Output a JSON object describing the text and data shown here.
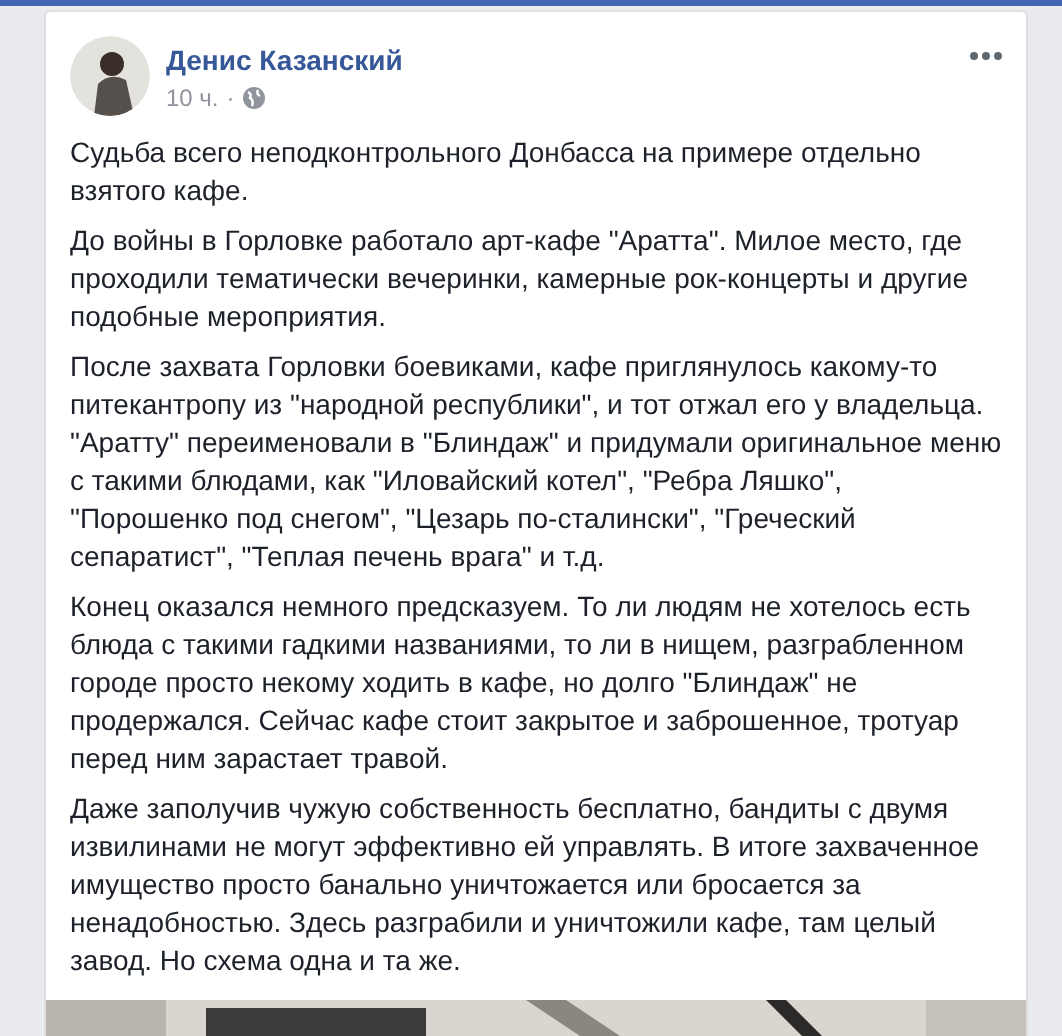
{
  "post": {
    "author": "Денис Казанский",
    "time": "10 ч.",
    "separator": "·",
    "paragraphs": [
      "Судьба всего неподконтрольного Донбасса на примере отдельно взятого кафе.",
      "До войны в Горловке работало арт-кафе \"Аратта\". Милое место, где проходили тематически вечеринки, камерные рок-концерты и другие подобные мероприятия.",
      "После захвата Горловки боевиками, кафе приглянулось какому-то питекантропу из \"народной республики\", и тот отжал его у владельца. \"Аратту\" переименовали в \"Блиндаж\" и придумали оригинальное меню с такими блюдами, как \"Иловайский котел\", \"Ребра Ляшко\", \"Порошенко под снегом\", \"Цезарь по-сталински\", \"Греческий сепаратист\", \"Теплая печень врага\" и т.д.",
      "Конец оказался немного предсказуем. То ли людям не хотелось есть блюда с такими гадкими названиями, то ли в нищем, разграбленном городе просто некому ходить в кафе, но долго \"Блиндаж\" не продержался. Сейчас кафе стоит закрытое и заброшенное, тротуар перед ним зарастает травой.",
      "Даже заполучив чужую собственность бесплатно, бандиты с двумя извилинами не могут эффективно ей управлять. В итоге захваченное имущество просто банально уничтожается или бросается за ненадобностью. Здесь разграбили и уничтожили кафе, там целый завод. Но схема одна и та же."
    ]
  }
}
